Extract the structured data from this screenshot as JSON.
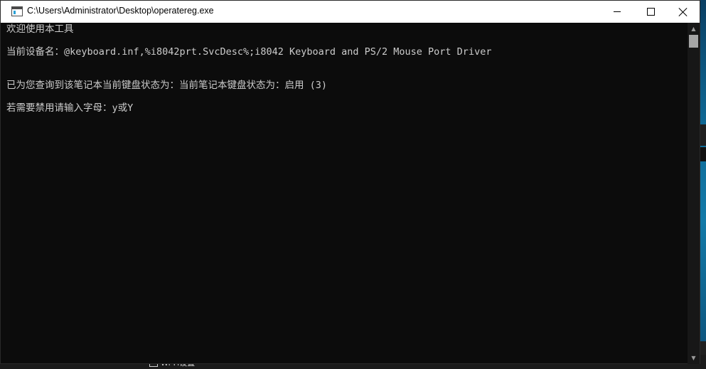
{
  "window": {
    "title": "C:\\Users\\Administrator\\Desktop\\operatereg.exe"
  },
  "console": {
    "lines": [
      "欢迎使用本工具",
      "当前设备名：@keyboard.inf,%i8042prt.SvcDesc%;i8042 Keyboard and PS/2 Mouse Port Driver",
      "已为您查询到该笔记本当前键盘状态为：当前笔记本键盘状态为：启用 (3)",
      "若需要禁用请输入字母：y或Y"
    ]
  },
  "taskbar": {
    "item_label": "Wi-Fi设置"
  },
  "colors": {
    "console_bg": "#0c0c0c",
    "console_text": "#cccccc",
    "titlebar_bg": "#ffffff"
  }
}
